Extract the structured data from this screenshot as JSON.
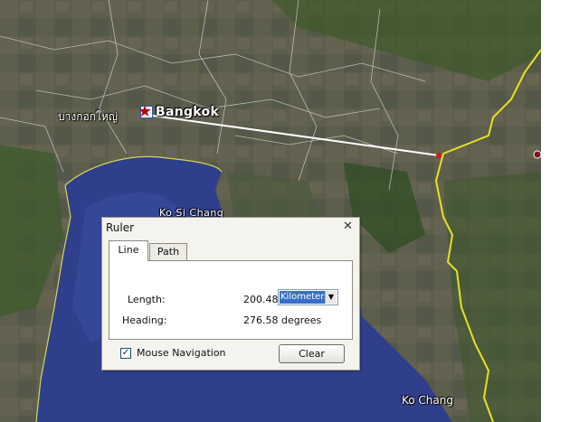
{
  "map": {
    "places": {
      "bangkok": "Bangkok",
      "bangkok_thai": "บางกอกใหญ่",
      "ko_si_chang": "Ko Si Chang",
      "ko_chang": "Ko Chang"
    },
    "colors": {
      "sea": "#2f3f8c",
      "land": "#5b5d49",
      "border_line": "#e8e020",
      "ruler_line": "#ffffff"
    }
  },
  "ruler": {
    "title": "Ruler",
    "close_icon": "close-icon",
    "tabs": [
      {
        "label": "Line",
        "active": true
      },
      {
        "label": "Path",
        "active": false
      }
    ],
    "length_label": "Length:",
    "length_value": "200.48",
    "unit": "Kilometers",
    "heading_label": "Heading:",
    "heading_value": "276.58 degrees",
    "mouse_navigation_label": "Mouse Navigation",
    "mouse_navigation_checked": true,
    "clear_label": "Clear"
  }
}
